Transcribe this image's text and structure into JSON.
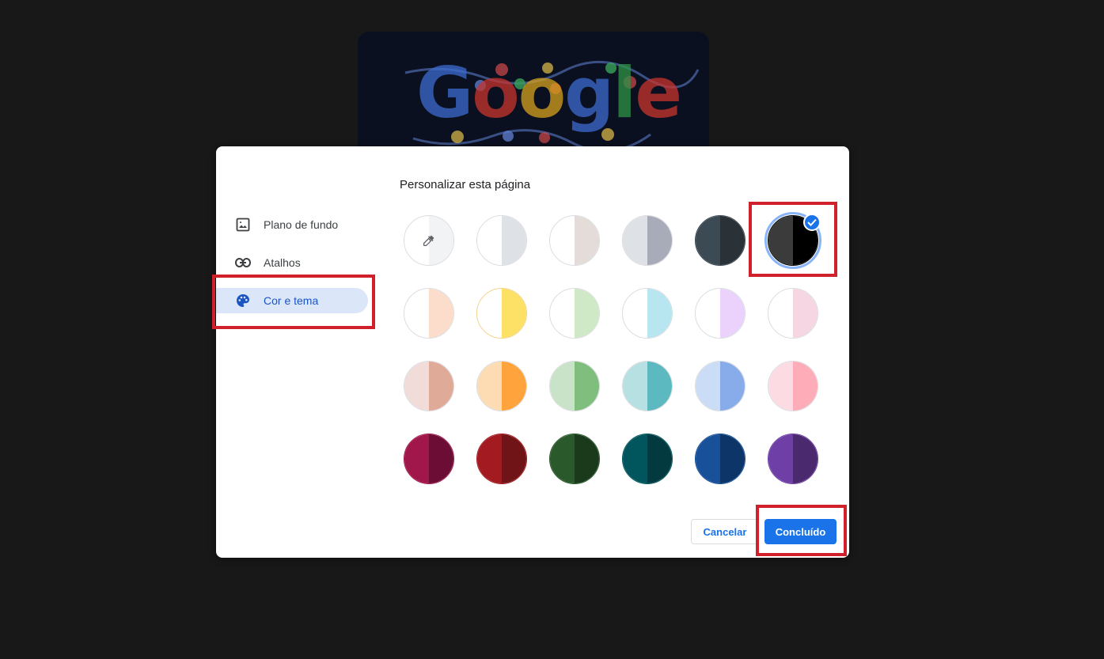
{
  "doodle": {
    "logo_letters": [
      {
        "ch": "G",
        "color": "#3d6bcf"
      },
      {
        "ch": "o",
        "color": "#c9342c"
      },
      {
        "ch": "o",
        "color": "#d6a21c"
      },
      {
        "ch": "g",
        "color": "#3d6bcf"
      },
      {
        "ch": "l",
        "color": "#2f9347"
      },
      {
        "ch": "e",
        "color": "#c9342c"
      }
    ]
  },
  "dialog": {
    "title": "Personalizar esta página",
    "nav": [
      {
        "label": "Plano de fundo",
        "icon": "image-icon",
        "active": false
      },
      {
        "label": "Atalhos",
        "icon": "link-icon",
        "active": false
      },
      {
        "label": "Cor e tema",
        "icon": "palette-icon",
        "active": true
      }
    ],
    "swatches": [
      {
        "left": "#ffffff",
        "right": "#f1f3f4",
        "type": "eyedropper"
      },
      {
        "left": "#ffffff",
        "right": "#dee1e6"
      },
      {
        "left": "#ffffff",
        "right": "#e3dcd8"
      },
      {
        "left": "#dee1e6",
        "right": "#a8abb8"
      },
      {
        "left": "#3c4a54",
        "right": "#2a3137"
      },
      {
        "left": "#3b3b3b",
        "right": "#000000",
        "selected": true
      },
      {
        "left": "#ffffff",
        "right": "#fcdcca"
      },
      {
        "left": "#ffffff",
        "right": "#fde066"
      },
      {
        "left": "#ffffff",
        "right": "#cfe8c6"
      },
      {
        "left": "#ffffff",
        "right": "#b8e6f0"
      },
      {
        "left": "#ffffff",
        "right": "#ead2fc"
      },
      {
        "left": "#ffffff",
        "right": "#f6d6e2"
      },
      {
        "left": "#f2dcd9",
        "right": "#e0aa99"
      },
      {
        "left": "#fddbb3",
        "right": "#ffa43d"
      },
      {
        "left": "#c8e3c8",
        "right": "#80be7d"
      },
      {
        "left": "#b7e0e2",
        "right": "#5bb9bf"
      },
      {
        "left": "#cbdcf7",
        "right": "#88acea"
      },
      {
        "left": "#fcdce2",
        "right": "#feadb8"
      },
      {
        "left": "#a1174c",
        "right": "#6b0d35"
      },
      {
        "left": "#a31b21",
        "right": "#711417"
      },
      {
        "left": "#2a5a2c",
        "right": "#1b3a1c"
      },
      {
        "left": "#01565e",
        "right": "#023a40"
      },
      {
        "left": "#18509a",
        "right": "#0e3567"
      },
      {
        "left": "#6e3fa6",
        "right": "#4b296e"
      }
    ],
    "cancel_label": "Cancelar",
    "done_label": "Concluído"
  },
  "colors": {
    "accent": "#1a73e8",
    "highlight": "#d0202b",
    "nav_active_bg": "#dbe6f8"
  }
}
